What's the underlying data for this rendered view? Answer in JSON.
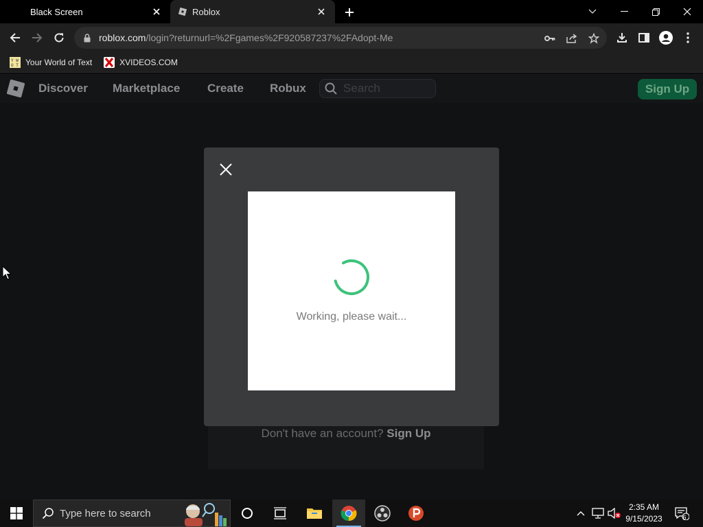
{
  "browser": {
    "tabs": [
      {
        "title": "Black Screen",
        "active": false
      },
      {
        "title": "Roblox",
        "active": true
      }
    ],
    "url_host": "roblox.com",
    "url_path": "/login?returnurl=%2Fgames%2F920587237%2FAdopt-Me",
    "bookmarks": [
      {
        "label": "Your World of Text",
        "icon": "yourworldoftext-icon"
      },
      {
        "label": "XVIDEOS.COM",
        "icon": "xvideos-icon"
      }
    ]
  },
  "site": {
    "nav": [
      "Discover",
      "Marketplace",
      "Create",
      "Robux"
    ],
    "search_placeholder": "Search",
    "signup_label": "Sign Up",
    "no_account_text": "Don't have an account?",
    "no_account_link": "Sign Up"
  },
  "modal": {
    "status_text": "Working, please wait..."
  },
  "taskbar": {
    "search_placeholder": "Type here to search",
    "time": "2:35 AM",
    "date": "9/15/2023",
    "notification_count": "6"
  },
  "colors": {
    "accent_green": "#00b06f",
    "page_bg": "#111214",
    "modal_bg": "#393b3d"
  }
}
